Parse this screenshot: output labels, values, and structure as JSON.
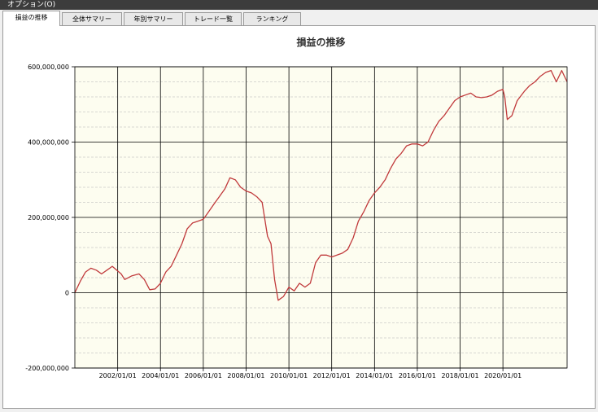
{
  "menu": {
    "options_label": "オプション(O)"
  },
  "tabs": [
    {
      "label": "損益の推移",
      "active": true
    },
    {
      "label": "全体サマリー",
      "active": false
    },
    {
      "label": "年別サマリー",
      "active": false
    },
    {
      "label": "トレード一覧",
      "active": false
    },
    {
      "label": "ランキング",
      "active": false
    }
  ],
  "colors": {
    "plot_background": "#fdfdf0",
    "series_line": "#c0393b",
    "major_grid": "#000000",
    "minor_grid": "#b4b4b4"
  },
  "chart_data": {
    "type": "line",
    "title": "損益の推移",
    "xlabel": "",
    "ylabel": "",
    "x_date_range": [
      "2000/01/01",
      "2022/12/31"
    ],
    "x_tick_labels": [
      "2002/01/01",
      "2004/01/01",
      "2006/01/01",
      "2008/01/01",
      "2010/01/01",
      "2012/01/01",
      "2014/01/01",
      "2016/01/01",
      "2018/01/01",
      "2020/01/01"
    ],
    "ylim": [
      -200000000,
      600000000
    ],
    "y_tick_values": [
      -200000000,
      0,
      200000000,
      400000000,
      600000000
    ],
    "y_tick_labels": [
      "-200,000,000",
      "0",
      "200,000,000",
      "400,000,000",
      "600,000,000"
    ],
    "grid": true,
    "minor_grid_step": 40000000,
    "legend": "none",
    "series": [
      {
        "x": [
          "2000/01/01",
          "2000/04/01",
          "2000/07/01",
          "2000/10/01",
          "2001/01/01",
          "2001/04/01",
          "2001/07/01",
          "2001/10/01",
          "2002/01/01",
          "2002/03/01",
          "2002/05/01",
          "2002/09/01",
          "2003/01/01",
          "2003/04/01",
          "2003/07/01",
          "2003/10/01",
          "2004/01/01",
          "2004/04/01",
          "2004/07/01",
          "2004/10/01",
          "2005/01/01",
          "2005/04/01",
          "2005/07/01",
          "2005/10/01",
          "2006/01/01",
          "2006/04/01",
          "2006/07/01",
          "2006/10/01",
          "2007/01/01",
          "2007/04/01",
          "2007/07/01",
          "2007/10/01",
          "2008/01/01",
          "2008/04/01",
          "2008/07/01",
          "2008/10/01",
          "2009/01/01",
          "2009/03/01",
          "2009/05/01",
          "2009/07/01",
          "2009/10/01",
          "2010/01/01",
          "2010/04/01",
          "2010/07/01",
          "2010/10/01",
          "2011/01/01",
          "2011/04/01",
          "2011/07/01",
          "2011/10/01",
          "2012/01/01",
          "2012/04/01",
          "2012/07/01",
          "2012/10/01",
          "2013/01/01",
          "2013/04/01",
          "2013/07/01",
          "2013/10/01",
          "2014/01/01",
          "2014/04/01",
          "2014/07/01",
          "2014/10/01",
          "2015/01/01",
          "2015/04/01",
          "2015/07/01",
          "2015/10/01",
          "2016/01/01",
          "2016/04/01",
          "2016/07/01",
          "2016/10/01",
          "2017/01/01",
          "2017/04/01",
          "2017/07/01",
          "2017/10/01",
          "2018/01/01",
          "2018/04/01",
          "2018/07/01",
          "2018/10/01",
          "2019/01/01",
          "2019/04/01",
          "2019/07/01",
          "2019/10/01",
          "2020/01/01",
          "2020/02/01",
          "2020/03/15",
          "2020/06/01",
          "2020/09/01",
          "2021/01/01",
          "2021/04/01",
          "2021/07/01",
          "2021/10/01",
          "2022/01/01",
          "2022/04/01",
          "2022/07/01",
          "2022/10/01",
          "2022/12/31"
        ],
        "values": [
          0,
          30000000,
          55000000,
          65000000,
          60000000,
          50000000,
          60000000,
          70000000,
          58000000,
          50000000,
          35000000,
          45000000,
          50000000,
          35000000,
          8000000,
          10000000,
          25000000,
          55000000,
          70000000,
          100000000,
          130000000,
          170000000,
          185000000,
          190000000,
          195000000,
          215000000,
          235000000,
          255000000,
          275000000,
          305000000,
          300000000,
          280000000,
          270000000,
          265000000,
          255000000,
          240000000,
          150000000,
          130000000,
          35000000,
          -20000000,
          -10000000,
          15000000,
          5000000,
          25000000,
          15000000,
          25000000,
          80000000,
          100000000,
          100000000,
          95000000,
          100000000,
          105000000,
          115000000,
          145000000,
          190000000,
          215000000,
          245000000,
          265000000,
          280000000,
          300000000,
          330000000,
          355000000,
          370000000,
          390000000,
          395000000,
          395000000,
          390000000,
          400000000,
          430000000,
          455000000,
          470000000,
          490000000,
          510000000,
          520000000,
          525000000,
          530000000,
          520000000,
          518000000,
          520000000,
          525000000,
          535000000,
          540000000,
          520000000,
          460000000,
          470000000,
          510000000,
          535000000,
          550000000,
          560000000,
          575000000,
          585000000,
          590000000,
          560000000,
          590000000,
          560000000
        ]
      }
    ]
  }
}
